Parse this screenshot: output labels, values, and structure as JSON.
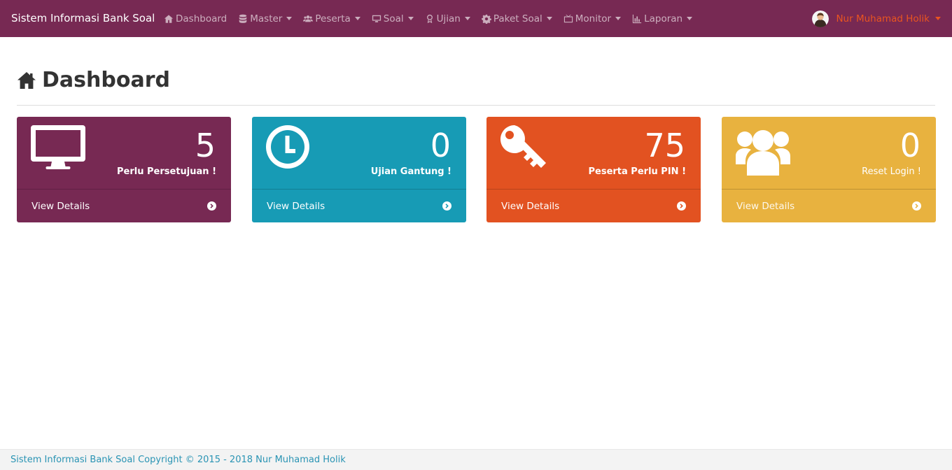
{
  "app": {
    "title": "Sistem Informasi Bank Soal"
  },
  "nav": {
    "items": [
      {
        "label": "Dashboard",
        "icon": "home-icon",
        "dropdown": false
      },
      {
        "label": "Master",
        "icon": "database-icon",
        "dropdown": true
      },
      {
        "label": "Peserta",
        "icon": "users-icon",
        "dropdown": true
      },
      {
        "label": "Soal",
        "icon": "desktop-icon",
        "dropdown": true
      },
      {
        "label": "Ujian",
        "icon": "award-icon",
        "dropdown": true
      },
      {
        "label": "Paket Soal",
        "icon": "gear-icon",
        "dropdown": true
      },
      {
        "label": "Monitor",
        "icon": "tv-icon",
        "dropdown": true
      },
      {
        "label": "Laporan",
        "icon": "bar-chart-icon",
        "dropdown": true
      }
    ],
    "user": "Nur Muhamad Holik"
  },
  "header": {
    "title": "Dashboard",
    "icon": "home-icon"
  },
  "panels": [
    {
      "count": "5",
      "label": "Perlu Persetujuan !",
      "link": "View Details",
      "icon": "desktop-icon",
      "color": "#772953"
    },
    {
      "count": "0",
      "label": "Ujian Gantung !",
      "link": "View Details",
      "icon": "clock-icon",
      "color": "#179bb5"
    },
    {
      "count": "75",
      "label": "Peserta Perlu PIN !",
      "link": "View Details",
      "icon": "key-icon",
      "color": "#e25221"
    },
    {
      "count": "0",
      "label": "Reset Login !",
      "link": "View Details",
      "icon": "users-icon",
      "color": "#e8b23f"
    }
  ],
  "footer": {
    "text": "Sistem Informasi Bank Soal Copyright © 2015 - 2018 Nur Muhamad Holik"
  },
  "colors": {
    "navbar": "#772953",
    "accent": "#e95420",
    "footer_text": "#2a94b4"
  }
}
